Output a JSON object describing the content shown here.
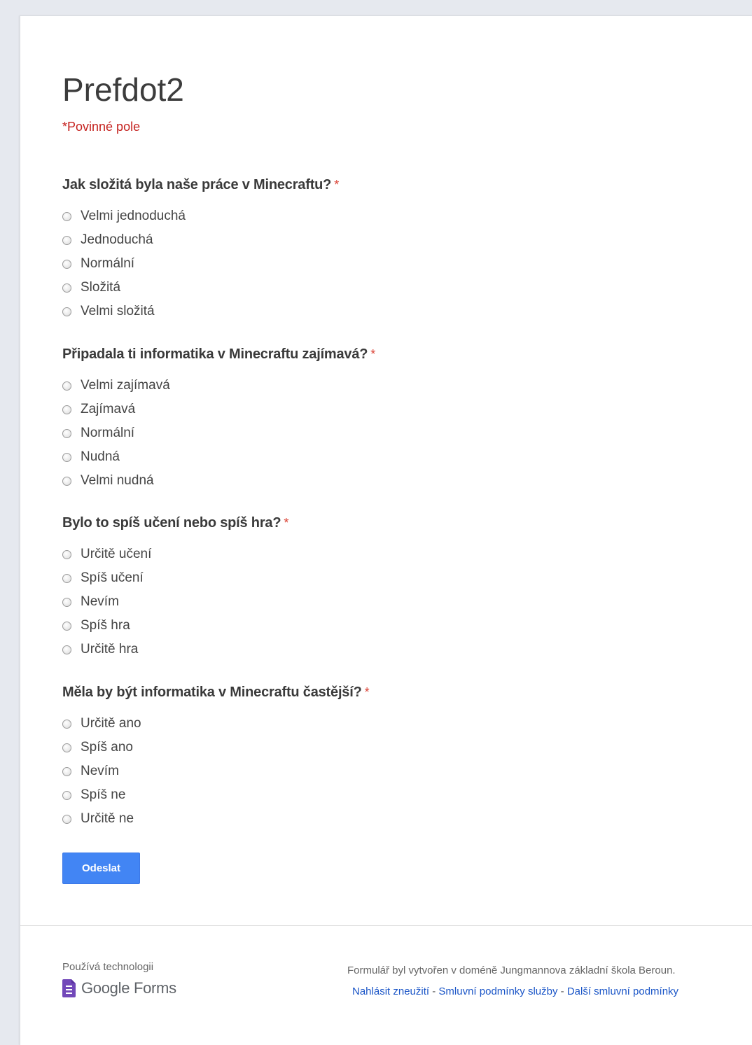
{
  "form": {
    "title": "Prefdot2",
    "required_note": "*Povinné pole",
    "submit_label": "Odeslat"
  },
  "questions": [
    {
      "title": "Jak složitá byla naše práce v Minecraftu?",
      "required_mark": "*",
      "options": [
        "Velmi jednoduchá",
        "Jednoduchá",
        "Normální",
        "Složitá",
        "Velmi složitá"
      ]
    },
    {
      "title": "Připadala ti informatika v Minecraftu zajímavá?",
      "required_mark": "*",
      "options": [
        "Velmi zajímavá",
        "Zajímavá",
        "Normální",
        "Nudná",
        "Velmi nudná"
      ]
    },
    {
      "title": "Bylo to spíš učení nebo spíš hra?",
      "required_mark": "*",
      "options": [
        "Určitě učení",
        "Spíš učení",
        "Nevím",
        "Spíš hra",
        "Určitě hra"
      ]
    },
    {
      "title": "Měla by být informatika v Minecraftu častější?",
      "required_mark": "*",
      "options": [
        "Určitě ano",
        "Spíš ano",
        "Nevím",
        "Spíš ne",
        "Určitě ne"
      ]
    }
  ],
  "footer": {
    "powered_by": "Používá technologii",
    "logo_text": "Google Forms",
    "logo_icon": "google-forms-icon",
    "created_note": "Formulář byl vytvořen v doméně Jungmannova základní škola Beroun.",
    "links": [
      "Nahlásit zneužití",
      "Smluvní podmínky služby",
      "Další smluvní podmínky"
    ],
    "link_separator": " - "
  },
  "colors": {
    "accent": "#4285f4",
    "required": "#db4437",
    "link": "#1a55c7",
    "logo": "#7248b9"
  }
}
